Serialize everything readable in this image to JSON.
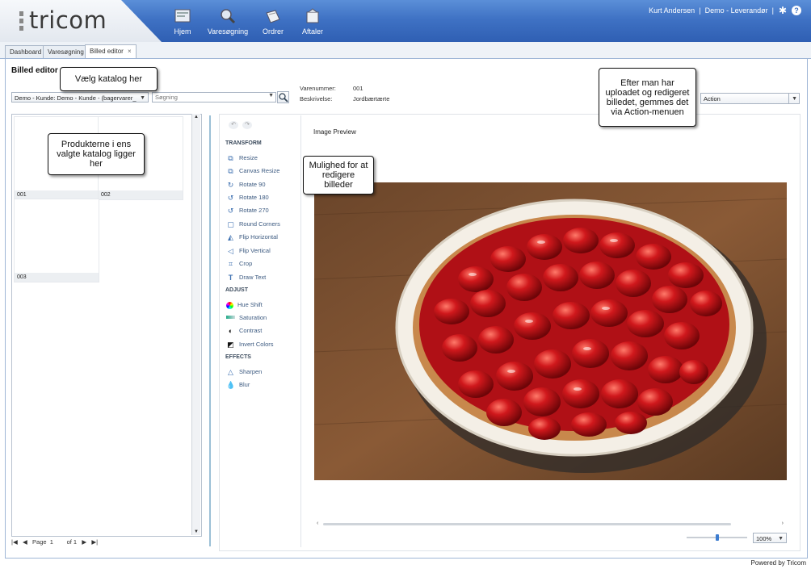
{
  "header": {
    "logo_text": "tricom",
    "nav": [
      {
        "label": "Hjem",
        "icon": "home-icon"
      },
      {
        "label": "Varesøgning",
        "icon": "search-icon"
      },
      {
        "label": "Ordrer",
        "icon": "orders-icon"
      },
      {
        "label": "Aftaler",
        "icon": "agreements-icon"
      }
    ],
    "user_name": "Kurt Andersen",
    "separator": "|",
    "account": "Demo - Leverandør",
    "help_label": "?"
  },
  "tabs": [
    {
      "label": "Dashboard"
    },
    {
      "label": "Varesøgning"
    },
    {
      "label": "Billed editor",
      "close": "×"
    }
  ],
  "page": {
    "title": "Billed editor",
    "catalog_select": "Demo - Kunde: Demo - Kunde - (bagervarer_",
    "search_placeholder": "Søgning",
    "varenummer_label": "Varenummer:",
    "varenummer_value": "001",
    "beskrivelse_label": "Beskrivelse:",
    "beskrivelse_value": "Jordbærtærte",
    "action_select": "Action"
  },
  "products": [
    {
      "code": "001"
    },
    {
      "code": "002"
    },
    {
      "code": "003"
    }
  ],
  "pager": {
    "page_label": "Page",
    "page_value": "1",
    "of_label": "of 1"
  },
  "editor": {
    "preview_title": "Image Preview",
    "groups": [
      {
        "title": "TRANSFORM",
        "tools": [
          "Resize",
          "Canvas Resize",
          "Rotate 90",
          "Rotate 180",
          "Rotate 270",
          "Round Corners",
          "Flip Horizontal",
          "Flip Vertical",
          "Crop",
          "Draw Text"
        ]
      },
      {
        "title": "ADJUST",
        "tools": [
          "Hue Shift",
          "Saturation",
          "Contrast",
          "Invert Colors"
        ]
      },
      {
        "title": "EFFECTS",
        "tools": [
          "Sharpen",
          "Blur"
        ]
      }
    ],
    "zoom": "100%"
  },
  "callouts": {
    "catalog": "Vælg katalog her",
    "products": "Produkterne i ens valgte katalog ligger her",
    "edit": "Mulighed for at redigere billeder",
    "action": "Efter man har uploadet og redigeret billedet, gemmes det via Action-menuen"
  },
  "footer": {
    "powered_by": "Powered by Tricom"
  },
  "colors": {
    "header_blue": "#3f72c4",
    "accent": "#3d7dd0"
  }
}
